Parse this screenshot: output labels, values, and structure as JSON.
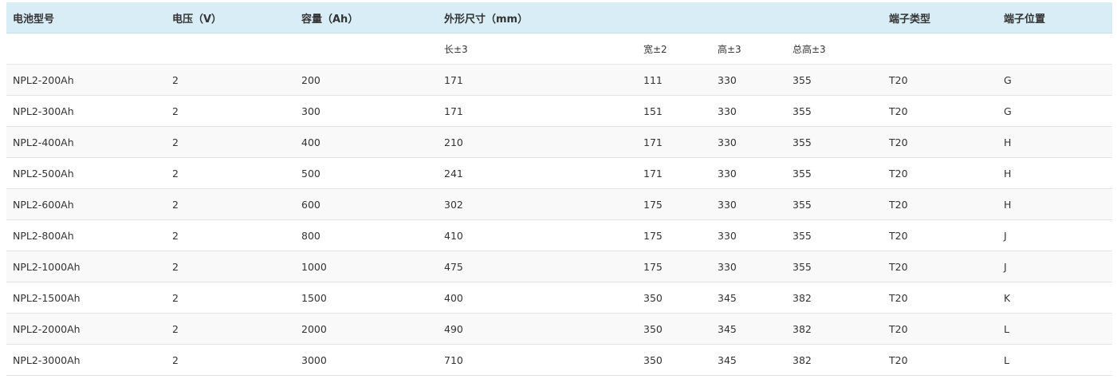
{
  "table": {
    "headers": {
      "model": "电池型号",
      "voltage": "电压（V）",
      "capacity": "容量（Ah）",
      "dimensions": "外形尺寸（mm）",
      "terminal_type": "端子类型",
      "terminal_position": "端子位置"
    },
    "subheaders": {
      "length": "长±3",
      "width": "宽±2",
      "height": "高±3",
      "total_height": "总高±3"
    },
    "rows": [
      [
        "NPL2-200Ah",
        "2",
        "200",
        "171",
        "111",
        "330",
        "355",
        "T20",
        "G"
      ],
      [
        "NPL2-300Ah",
        "2",
        "300",
        "171",
        "151",
        "330",
        "355",
        "T20",
        "G"
      ],
      [
        "NPL2-400Ah",
        "2",
        "400",
        "210",
        "171",
        "330",
        "355",
        "T20",
        "H"
      ],
      [
        "NPL2-500Ah",
        "2",
        "500",
        "241",
        "171",
        "330",
        "355",
        "T20",
        "H"
      ],
      [
        "NPL2-600Ah",
        "2",
        "600",
        "302",
        "175",
        "330",
        "355",
        "T20",
        "H"
      ],
      [
        "NPL2-800Ah",
        "2",
        "800",
        "410",
        "175",
        "330",
        "355",
        "T20",
        "J"
      ],
      [
        "NPL2-1000Ah",
        "2",
        "1000",
        "475",
        "175",
        "330",
        "355",
        "T20",
        "J"
      ],
      [
        "NPL2-1500Ah",
        "2",
        "1500",
        "400",
        "350",
        "345",
        "382",
        "T20",
        "K"
      ],
      [
        "NPL2-2000Ah",
        "2",
        "2000",
        "490",
        "350",
        "345",
        "382",
        "T20",
        "L"
      ],
      [
        "NPL2-3000Ah",
        "2",
        "3000",
        "710",
        "350",
        "345",
        "382",
        "T20",
        "L"
      ]
    ]
  }
}
